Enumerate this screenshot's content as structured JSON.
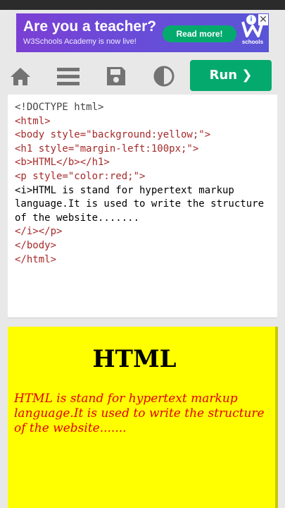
{
  "ad": {
    "title": "Are you a teacher?",
    "subtitle": "W3Schools Academy is now live!",
    "button": "Read more!",
    "logo_text": "schools",
    "info_icon": "info-icon",
    "close_icon": "close-icon",
    "colors": {
      "accent": "#04aa6d",
      "bg": "#6b4bd8"
    }
  },
  "toolbar": {
    "icons": [
      "home-icon",
      "menu-icon",
      "save-icon",
      "contrast-icon"
    ],
    "run_label": "Run ❯",
    "run_color": "#04aa6d"
  },
  "editor": {
    "lines": [
      "<!DOCTYPE html>",
      "<html>",
      "<body style=\"background:yellow;\">",
      "<h1 style=\"margin-left:100px;\">",
      "<b>HTML</b></h1>",
      "<p style=\"color:red;\">",
      "<i>HTML is stand for hypertext markup language.It is used to write the structure of the website.......",
      "</i></p>",
      "</body>",
      "</html>"
    ]
  },
  "result": {
    "heading": "HTML",
    "paragraph": "HTML is stand for hypertext markup language.It is used to write the structure of the website.......",
    "bg_color": "#ffff00",
    "text_color": "#e00000"
  }
}
